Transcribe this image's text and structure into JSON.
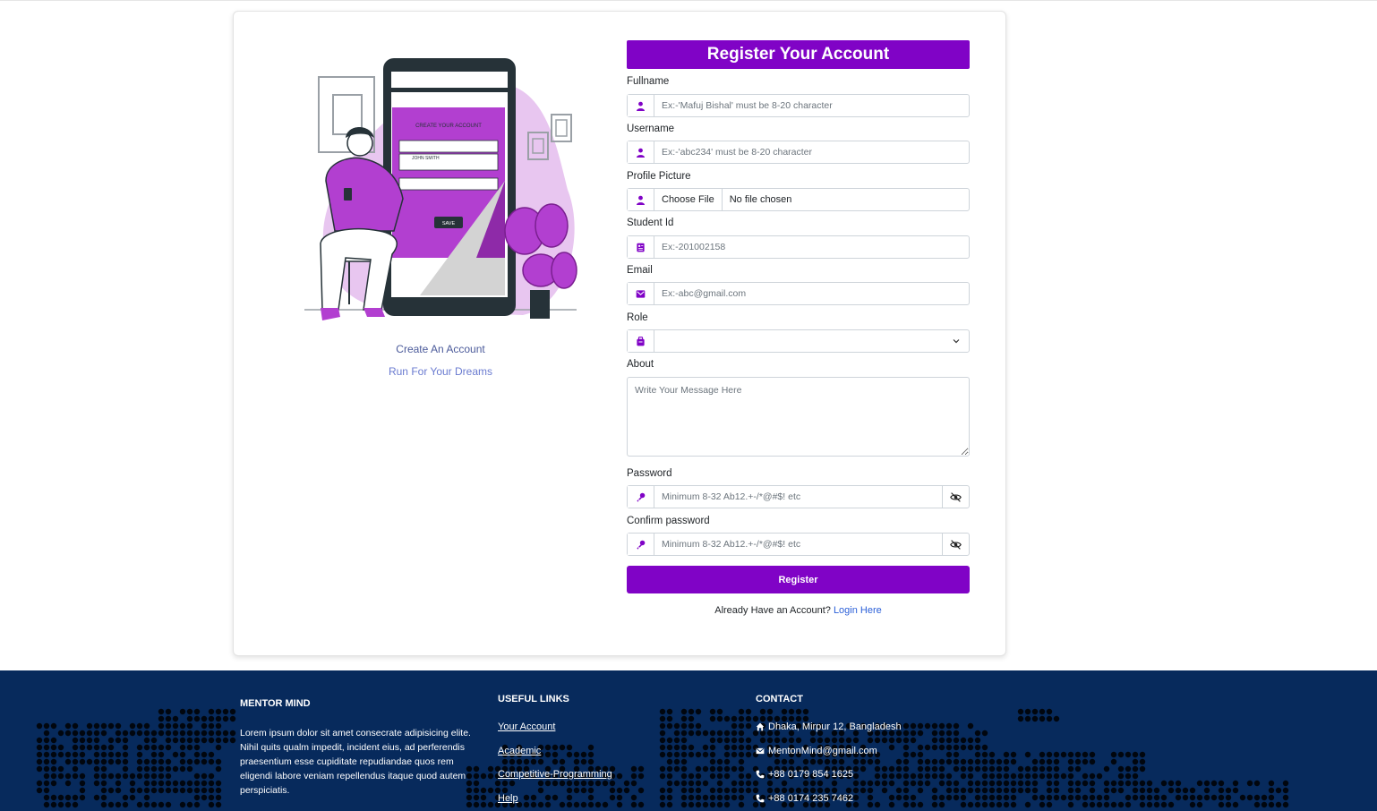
{
  "form": {
    "title": "Register Your Account",
    "fields": {
      "fullname": {
        "label": "Fullname",
        "placeholder": "Ex:-'Mafuj Bishal' must be 8-20 character"
      },
      "username": {
        "label": "Username",
        "placeholder": "Ex:-'abc234' must be 8-20 character"
      },
      "profile_picture": {
        "label": "Profile Picture",
        "button": "Choose File",
        "status": "No file chosen"
      },
      "student_id": {
        "label": "Student Id",
        "placeholder": "Ex:-201002158"
      },
      "email": {
        "label": "Email",
        "placeholder": "Ex:-abc@gmail.com"
      },
      "role": {
        "label": "Role",
        "value": ""
      },
      "about": {
        "label": "About",
        "placeholder": "Write Your Message Here"
      },
      "password": {
        "label": "Password",
        "placeholder": "Minimum 8-32 Ab12.+-/*@#$! etc"
      },
      "confirm_password": {
        "label": "Confirm password",
        "placeholder": "Minimum 8-32 Ab12.+-/*@#$! etc"
      }
    },
    "submit_label": "Register",
    "already_text": "Already Have an Account?",
    "login_link": "Login Here"
  },
  "side": {
    "line1": "Create An Account",
    "line2": "Run For Your Dreams",
    "phone_text": {
      "header": "CREATE YOUR ACCOUNT",
      "name": "JOHN SMITH",
      "save": "SAVE"
    }
  },
  "footer": {
    "about": {
      "heading": "MENTOR MIND",
      "text": "Lorem ipsum dolor sit amet consecrate adipisicing elite. Nihil quits qualm impedit, incident eius, ad perferendis praesentium esse cupiditate repudiandae quos rem eligendi labore veniam repellendus itaque quod autem perspiciatis."
    },
    "links": {
      "heading": "USEFUL LINKS",
      "items": [
        "Your Account",
        "Academic",
        "Competitive-Programming",
        "Help"
      ]
    },
    "contact": {
      "heading": "CONTACT",
      "address": "Dhaka, Mirpur 12, Bangladesh",
      "email": "MentonMind@gmail.com",
      "phone1": "+88 0179 854 1625",
      "phone2": "+88 0174 235 7462"
    }
  },
  "colors": {
    "accent": "#8003c6",
    "footer_bg": "#072a5c",
    "link": "#2a5fd8"
  }
}
